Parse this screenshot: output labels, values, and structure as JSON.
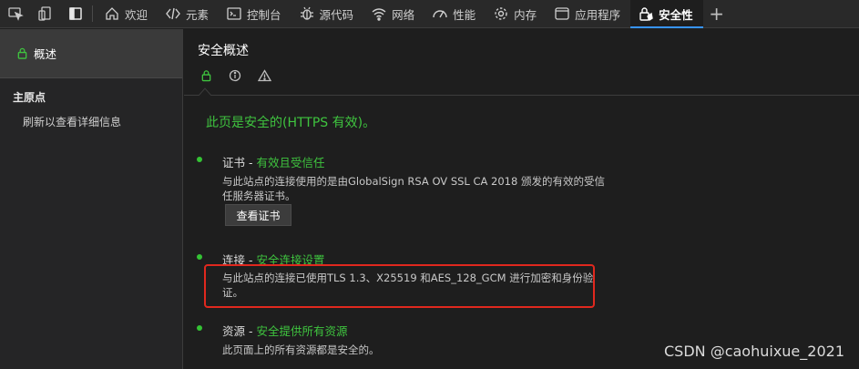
{
  "toolbar": {
    "inspect_icon": "inspect-icon",
    "device_icon": "device-emulation-icon",
    "dock_icon": "dock-panel-icon"
  },
  "tabs": [
    {
      "label": "欢迎",
      "icon": "home-icon"
    },
    {
      "label": "元素",
      "icon": "code-tag-icon"
    },
    {
      "label": "控制台",
      "icon": "console-icon"
    },
    {
      "label": "源代码",
      "icon": "bug-icon"
    },
    {
      "label": "网络",
      "icon": "wifi-icon"
    },
    {
      "label": "性能",
      "icon": "gauge-icon"
    },
    {
      "label": "内存",
      "icon": "gear-icon"
    },
    {
      "label": "应用程序",
      "icon": "window-icon"
    },
    {
      "label": "安全性",
      "icon": "shield-hand-icon",
      "active": true
    }
  ],
  "add_tab": "+",
  "sidebar": {
    "selected": "概述",
    "group": "主原点",
    "sub": "刷新以查看详细信息"
  },
  "main": {
    "title": "安全概述",
    "summary": "此页是安全的(HTTPS 有效)。",
    "cert": {
      "label": "证书",
      "status": "有效且受信任",
      "desc": "与此站点的连接使用的是由GlobalSign RSA OV SSL CA 2018 颁发的有效的受信任服务器证书。",
      "button": "查看证书"
    },
    "conn": {
      "label": "连接",
      "status": "安全连接设置",
      "desc": "与此站点的连接已使用TLS 1.3、X25519 和AES_128_GCM 进行加密和身份验证。"
    },
    "res": {
      "label": "资源",
      "status": "安全提供所有资源",
      "desc": "此页面上的所有资源都是安全的。"
    }
  },
  "separator": " - ",
  "watermark": "CSDN @caohuixue_2021",
  "colors": {
    "secure_green": "#3fc43f",
    "highlight_red": "#e0281e",
    "accent_blue": "#3794ff"
  }
}
